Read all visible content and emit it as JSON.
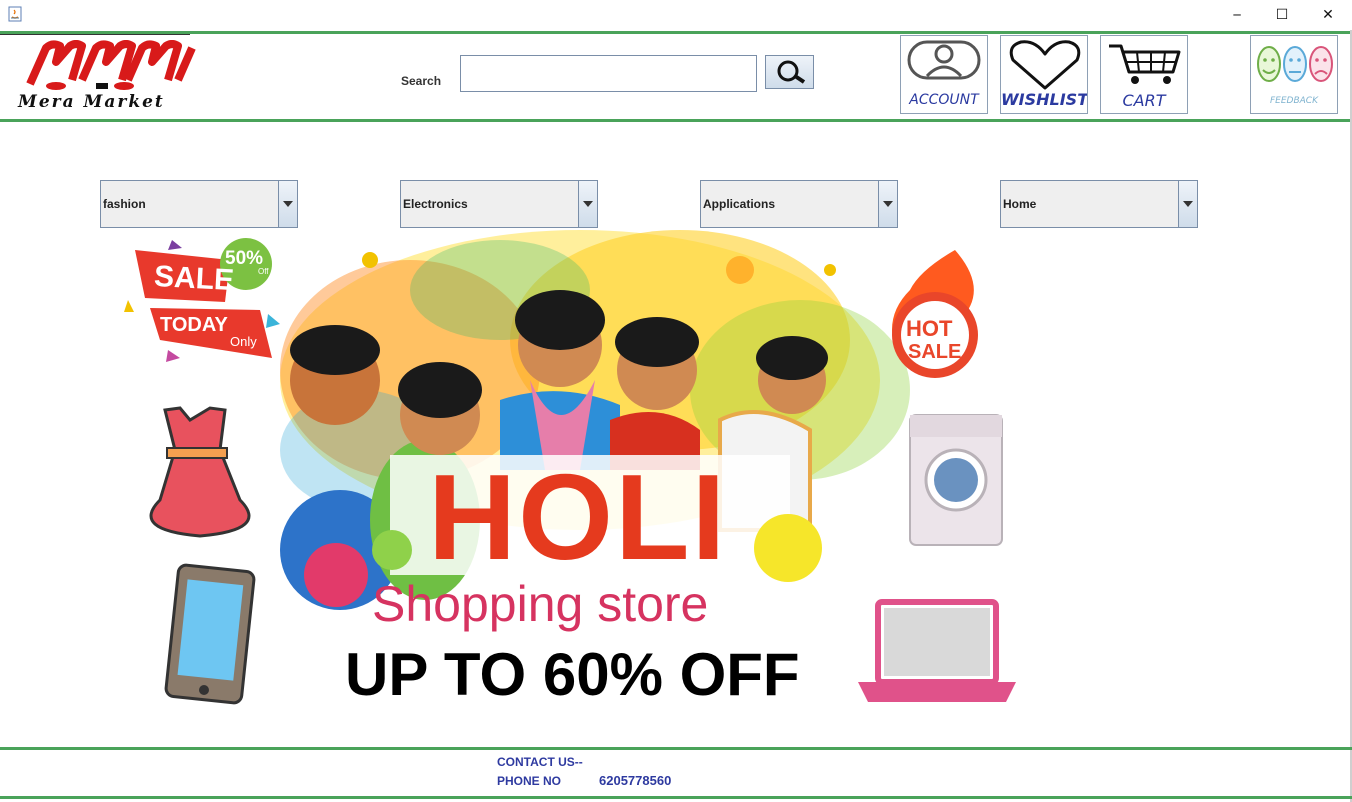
{
  "window": {
    "minimize_glyph": "─",
    "maximize_glyph": "☐",
    "close_glyph": "✕"
  },
  "header": {
    "logo_text": "Mera Market",
    "search_label": "Search",
    "search_value": "",
    "account_label": "ACCOUNT",
    "wishlist_label": "WISHLIST",
    "cart_label": "CART",
    "feedback_label": "FEEDBACK"
  },
  "categories": [
    {
      "selected": "fashion"
    },
    {
      "selected": "Electronics"
    },
    {
      "selected": "Applications"
    },
    {
      "selected": "Home"
    }
  ],
  "banner": {
    "sale_text": "SALE",
    "percent_text": "50%",
    "off_small": "Off",
    "today_text": "TODAY",
    "only_text": "Only",
    "hot_text": "HOT",
    "hot_sale_text": "SALE",
    "holi_text": "HOLI",
    "store_text": "Shopping store",
    "offer_text": "UP TO 60% OFF"
  },
  "footer": {
    "contact_label": "CONTACT US--",
    "phone_label": "PHONE NO",
    "phone_number": "6205778560"
  },
  "colors": {
    "accent_green": "#4aa35a",
    "label_blue": "#2e3aa0",
    "holi_red": "#e53a1e",
    "store_pink": "#d63360"
  }
}
